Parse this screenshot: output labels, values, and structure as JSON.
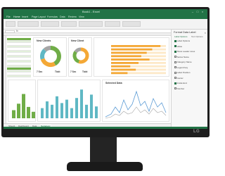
{
  "monitor": {
    "brand": "LG"
  },
  "app": {
    "window_title": "Book1 - Excel",
    "tabs": [
      "File",
      "Home",
      "Insert",
      "Page Layout",
      "Formulas",
      "Data",
      "Review",
      "View"
    ],
    "formula_label": "fx"
  },
  "charts": {
    "donut_card": {
      "title": "New Clients",
      "left_value": "7 Sec",
      "right_value": "Tickt",
      "segments": [
        0.42,
        0.28,
        0.18,
        0.12
      ]
    },
    "donut_card_2": {
      "title": "New Client",
      "left_value": "7 Sec",
      "right_value": "Tickt",
      "segments": [
        0.55,
        0.3,
        0.15
      ]
    },
    "hbar_card": {
      "values": [
        0.9,
        0.75,
        0.65,
        0.55,
        0.7,
        0.5,
        0.35,
        0.45,
        0.3
      ]
    },
    "green_bars": {
      "values": [
        0.25,
        0.45,
        0.75,
        0.35,
        0.2
      ]
    },
    "teal_bars": {
      "values": [
        0.3,
        0.5,
        0.4,
        0.65,
        0.45,
        0.55,
        0.3,
        0.6,
        0.85,
        0.4,
        0.7,
        0.35
      ]
    },
    "line_card": {
      "title": "Selected Data"
    }
  },
  "sheet_tabs": [
    "Sheet1",
    "Dashboard",
    "Data",
    "Summary"
  ],
  "side_pane": {
    "title": "Format Data Label",
    "close": "×",
    "tab_1": "Label Options",
    "tab_2": "Text Options",
    "items": [
      {
        "label": "Label Options",
        "on": true
      },
      {
        "label": "Value",
        "on": true
      },
      {
        "label": "Show Leader Lines",
        "on": true
      },
      {
        "label": "Series Name",
        "on": false
      },
      {
        "label": "Category Name",
        "on": false
      },
      {
        "label": "Legend key",
        "on": false
      },
      {
        "label": "Label Position",
        "on": false
      },
      {
        "label": "Center",
        "on": false
      },
      {
        "label": "Inside End",
        "on": true
      },
      {
        "label": "Number",
        "on": false
      }
    ]
  },
  "colors": {
    "excel_green": "#217346",
    "bar_orange": "#f4a836",
    "bar_green": "#70ad47",
    "bar_teal": "#5fb8c4",
    "line_blue": "#5b9bd5"
  }
}
